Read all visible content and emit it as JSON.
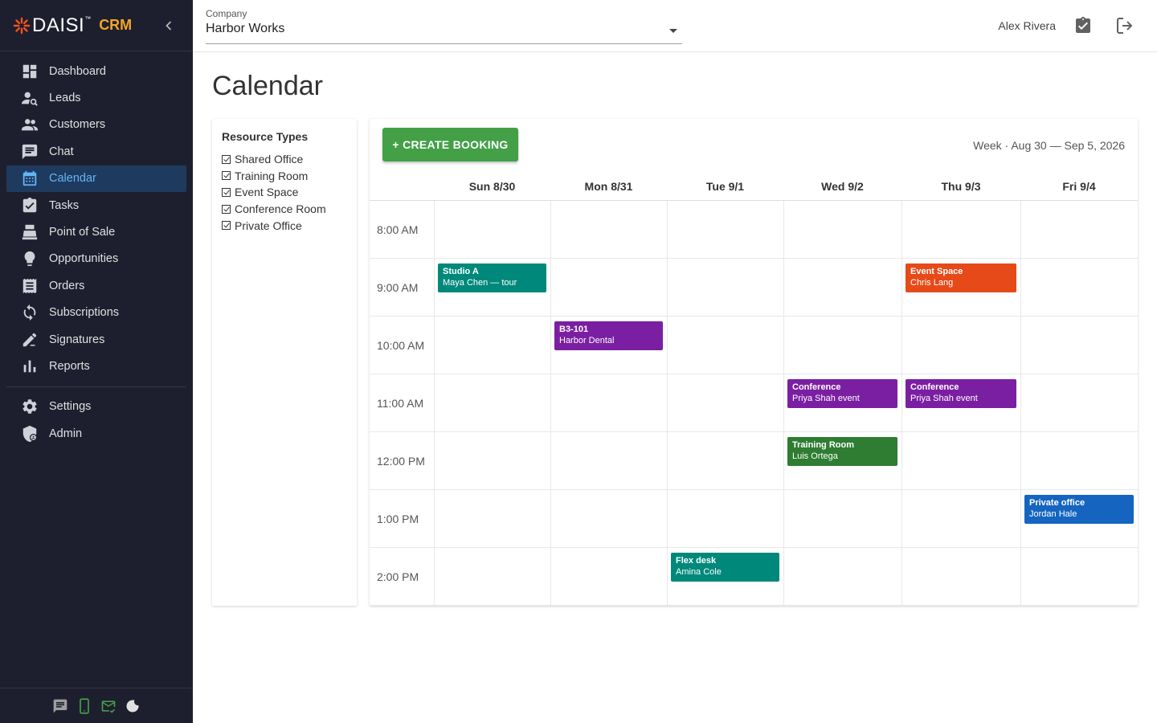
{
  "app": {
    "brand_name": "DAISI",
    "brand_tm": "™",
    "brand_product": "CRM"
  },
  "sidebar": {
    "items": [
      {
        "label": "Dashboard",
        "icon": "dashboard-icon"
      },
      {
        "label": "Leads",
        "icon": "leads-icon"
      },
      {
        "label": "Customers",
        "icon": "customers-icon"
      },
      {
        "label": "Chat",
        "icon": "chat-icon"
      },
      {
        "label": "Calendar",
        "icon": "calendar-icon",
        "active": true
      },
      {
        "label": "Tasks",
        "icon": "tasks-icon"
      },
      {
        "label": "Point of Sale",
        "icon": "point-of-sale-icon"
      },
      {
        "label": "Opportunities",
        "icon": "lightbulb-icon"
      },
      {
        "label": "Orders",
        "icon": "orders-icon"
      },
      {
        "label": "Subscriptions",
        "icon": "subscriptions-icon"
      },
      {
        "label": "Signatures",
        "icon": "signature-icon"
      },
      {
        "label": "Reports",
        "icon": "reports-icon"
      }
    ],
    "bottom_items": [
      {
        "label": "Settings",
        "icon": "gear-icon"
      },
      {
        "label": "Admin",
        "icon": "admin-shield-icon"
      }
    ],
    "footer_icons": [
      "chat-bubble-icon",
      "phone-icon",
      "mail-check-icon",
      "dark-mode-icon"
    ]
  },
  "topbar": {
    "company_label": "Company",
    "company_value": "Harbor Works",
    "user_name": "Alex Rivera"
  },
  "page": {
    "title": "Calendar"
  },
  "filters": {
    "title": "Resource Types",
    "items": [
      {
        "label": "Shared Office",
        "checked": true
      },
      {
        "label": "Training Room",
        "checked": true
      },
      {
        "label": "Event Space",
        "checked": true
      },
      {
        "label": "Conference Room",
        "checked": true
      },
      {
        "label": "Private Office",
        "checked": true
      }
    ]
  },
  "calendar": {
    "create_button": "+ CREATE BOOKING",
    "week_label": "Week · Aug 30 — Sep 5, 2026",
    "days": [
      "Sun 8/30",
      "Mon 8/31",
      "Tue 9/1",
      "Wed 9/2",
      "Thu 9/3",
      "Fri 9/4"
    ],
    "times": [
      "8:00 AM",
      "9:00 AM",
      "10:00 AM",
      "11:00 AM",
      "12:00 PM",
      "1:00 PM",
      "2:00 PM"
    ],
    "colors": {
      "teal": "#00897b",
      "purple": "#7b1fa2",
      "orange": "#e64a19",
      "green": "#2e7d32",
      "blue": "#1565c0"
    },
    "events": [
      {
        "title": "Studio A",
        "subtitle": "Maya Chen — tour",
        "day": 0,
        "slot": 1,
        "color": "#00897b"
      },
      {
        "title": "Event Space",
        "subtitle": "Chris Lang",
        "day": 4,
        "slot": 1,
        "color": "#e64a19"
      },
      {
        "title": "B3-101",
        "subtitle": "Harbor Dental",
        "day": 1,
        "slot": 2,
        "color": "#7b1fa2"
      },
      {
        "title": "Conference",
        "subtitle": "Priya Shah event",
        "day": 3,
        "slot": 3,
        "color": "#7b1fa2"
      },
      {
        "title": "Conference",
        "subtitle": "Priya Shah event",
        "day": 4,
        "slot": 3,
        "color": "#7b1fa2"
      },
      {
        "title": "Training Room",
        "subtitle": "Luis Ortega",
        "day": 3,
        "slot": 4,
        "color": "#2e7d32"
      },
      {
        "title": "Private office",
        "subtitle": "Jordan Hale",
        "day": 5,
        "slot": 5,
        "color": "#1565c0"
      },
      {
        "title": "Flex desk",
        "subtitle": "Amina Cole",
        "day": 2,
        "slot": 6,
        "color": "#00897b"
      }
    ]
  }
}
